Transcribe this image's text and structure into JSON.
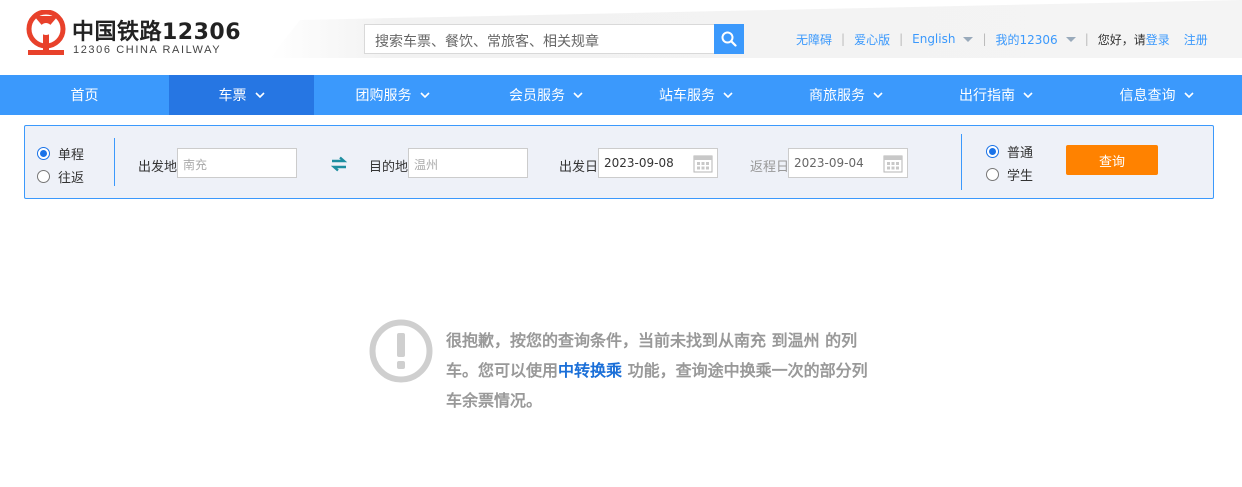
{
  "brand": {
    "title": "中国铁路12306",
    "subtitle": "12306 CHINA RAILWAY",
    "logo_icon": "railway-logo-icon",
    "logo_color": "#e8412b"
  },
  "search": {
    "placeholder": "搜索车票、餐饮、常旅客、相关规章",
    "icon": "search-icon"
  },
  "top_links": {
    "accessibility": "无障碍",
    "care_edition": "爱心版",
    "language": "English",
    "my_account": "我的12306",
    "greeting": "您好，请",
    "login": "登录",
    "register": "注册"
  },
  "nav": {
    "items": [
      {
        "label": "首页"
      },
      {
        "label": "车票"
      },
      {
        "label": "团购服务"
      },
      {
        "label": "会员服务"
      },
      {
        "label": "站车服务"
      },
      {
        "label": "商旅服务"
      },
      {
        "label": "出行指南"
      },
      {
        "label": "信息查询"
      }
    ],
    "active": "车票",
    "color": "#3b99fc",
    "active_color": "#2676e3"
  },
  "query": {
    "trip_types": [
      "单程",
      "往返"
    ],
    "trip_selected": "单程",
    "from_label": "出发地",
    "from_value": "南充",
    "to_label": "目的地",
    "to_value": "温州",
    "depart_label": "出发日",
    "depart_value": "2023-09-08",
    "return_label": "返程日",
    "return_value": "2023-09-04",
    "passenger_types": [
      "普通",
      "学生"
    ],
    "passenger_selected": "普通",
    "submit_label": "查询",
    "submit_color": "#ff8200"
  },
  "empty_state": {
    "icon": "exclamation-circle-icon",
    "text_before": "很抱歉，按您的查询条件，当前未找到从南充 到温州 的列车。您可以使用",
    "link_text": "中转换乘",
    "text_after": " 功能，查询途中换乘一次的部分列车余票情况。"
  }
}
